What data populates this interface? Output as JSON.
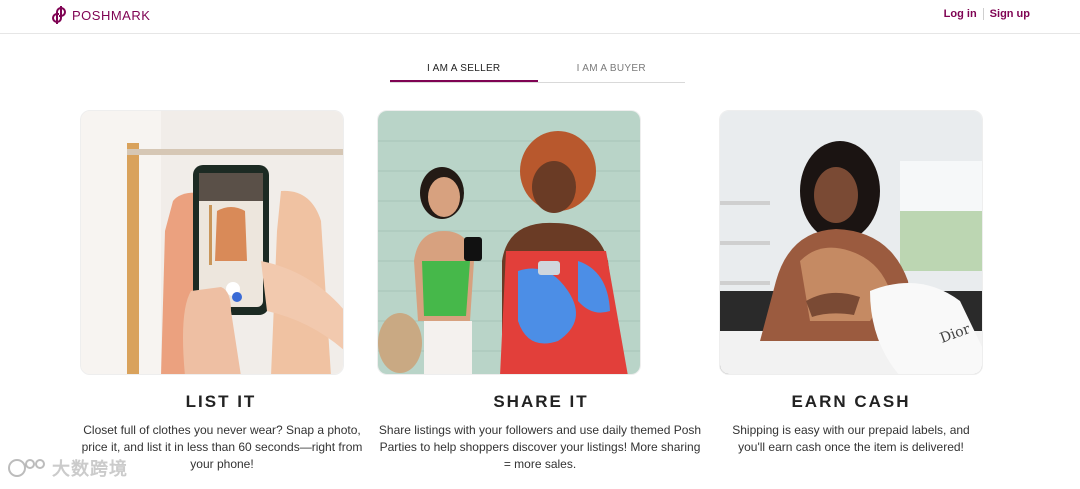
{
  "header": {
    "logo_text": "POSHMARK",
    "login": "Log in",
    "signup": "Sign up"
  },
  "tabs": [
    {
      "label": "I AM A SELLER",
      "active": true
    },
    {
      "label": "I AM A BUYER",
      "active": false
    }
  ],
  "cards": [
    {
      "title": "LIST IT",
      "text": "Closet full of clothes you never wear? Snap a photo, price it, and list it in less than 60 seconds—right from your phone!"
    },
    {
      "title": "SHARE IT",
      "text": "Share listings with your followers and use daily themed Posh Parties to help shoppers discover your listings! More sharing = more sales."
    },
    {
      "title": "EARN CASH",
      "text": "Shipping is easy with our prepaid labels, and you'll earn cash once the item is delivered!"
    }
  ],
  "watermark": {
    "text": "大数跨境"
  },
  "colors": {
    "brand": "#7f0353"
  }
}
